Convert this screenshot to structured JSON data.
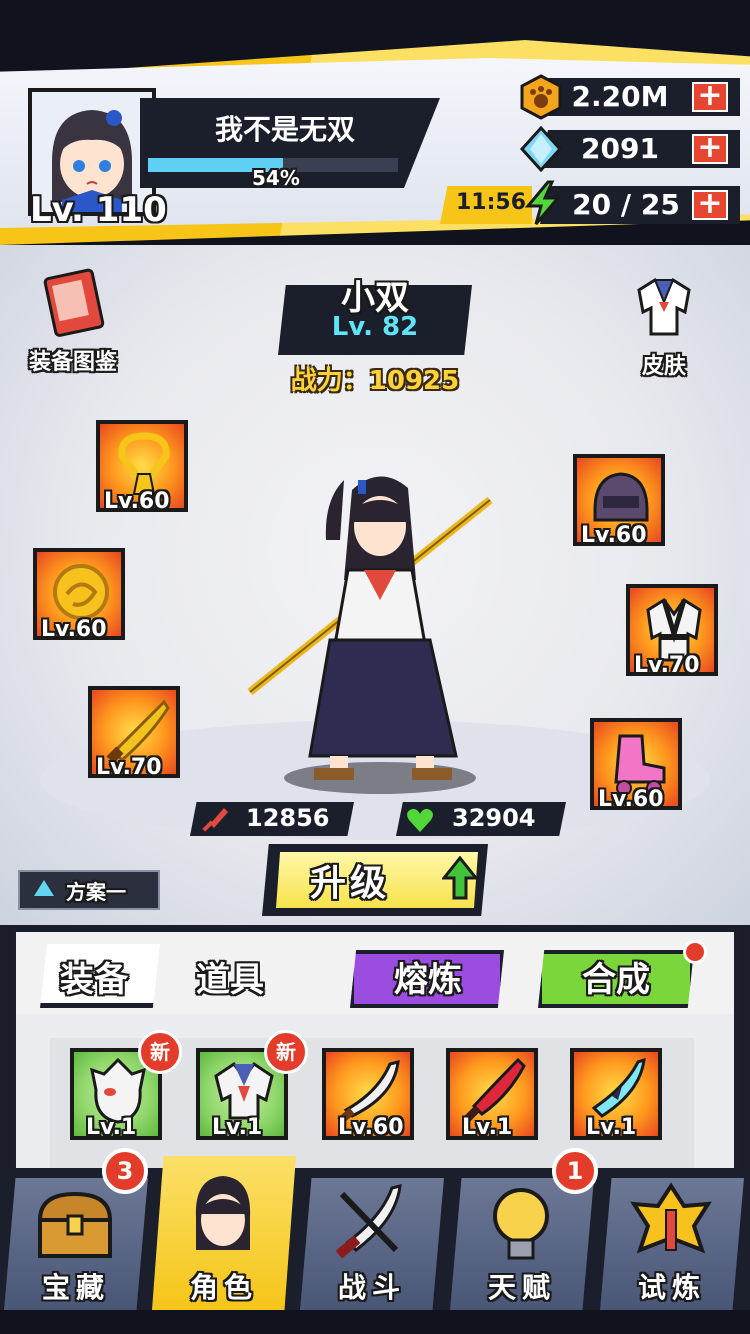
{
  "player": {
    "name": "我不是无双",
    "level": "Lv. 110",
    "exp_percent": "54%",
    "exp_fraction": 0.54
  },
  "resources": {
    "gold": "2.20M",
    "gems": "2091",
    "energy": "20 / 25",
    "energy_timer": "11:56"
  },
  "character": {
    "name": "小双",
    "level": "Lv. 82",
    "power": "战力：10925",
    "attack": "12856",
    "hp": "32904"
  },
  "side_buttons": {
    "codex": "装备图鉴",
    "skin": "皮肤"
  },
  "equipment_slots": {
    "left": [
      {
        "icon": "amulet-icon",
        "level": "Lv.60"
      },
      {
        "icon": "ring-icon",
        "level": "Lv.60"
      },
      {
        "icon": "blade-icon",
        "level": "Lv.70"
      }
    ],
    "right": [
      {
        "icon": "helmet-icon",
        "level": "Lv.60"
      },
      {
        "icon": "uniform-icon",
        "level": "Lv.70"
      },
      {
        "icon": "roller-skate-icon",
        "level": "Lv.60"
      }
    ]
  },
  "upgrade_label": "升级",
  "plan_label": "方案一",
  "inventory": {
    "tabs": [
      "装备",
      "道具"
    ],
    "smelt_label": "熔炼",
    "combine_label": "合成",
    "new_badge": "新",
    "items": [
      {
        "icon": "mask-icon",
        "level": "Lv.1",
        "is_new": true,
        "bg": "#8fd66a"
      },
      {
        "icon": "sailor-top-icon",
        "level": "Lv.1",
        "is_new": true,
        "bg": "#8fd66a"
      },
      {
        "icon": "scimitar-icon",
        "level": "Lv.60",
        "is_new": false,
        "bg": "#ff9a1e"
      },
      {
        "icon": "red-sword-icon",
        "level": "Lv.1",
        "is_new": false,
        "bg": "#ff9a1e"
      },
      {
        "icon": "ice-blade-icon",
        "level": "Lv.1",
        "is_new": false,
        "bg": "#ff9a1e"
      }
    ]
  },
  "nav": {
    "items": [
      {
        "label": "宝藏",
        "icon": "treasure-chest-icon",
        "badge": "3"
      },
      {
        "label": "角色",
        "icon": "character-icon",
        "badge": ""
      },
      {
        "label": "战斗",
        "icon": "crossed-swords-icon",
        "badge": ""
      },
      {
        "label": "天赋",
        "icon": "lightbulb-icon",
        "badge": "1"
      },
      {
        "label": "试炼",
        "icon": "trial-emblem-icon",
        "badge": ""
      }
    ],
    "active_index": 1
  },
  "colors": {
    "accent_yellow": "#f6c518",
    "dark_panel": "#1b1f2c",
    "cyan": "#5fe3f5",
    "badge_red": "#e33c2a",
    "smelt_purple": "#9b4de0",
    "combine_green": "#7ad63a"
  }
}
